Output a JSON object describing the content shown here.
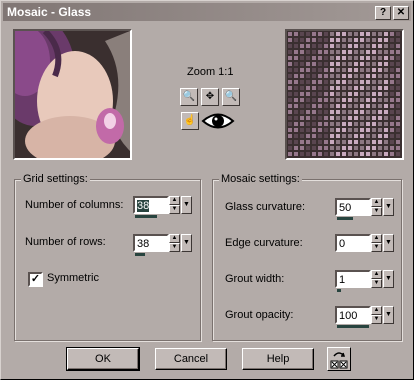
{
  "window": {
    "title": "Mosaic - Glass",
    "help_btn": "?",
    "close_btn": "✕"
  },
  "preview": {
    "zoom_label": "Zoom 1:1"
  },
  "grid": {
    "title": "Grid settings:",
    "columns_label": "Number of columns:",
    "columns_value": "38",
    "rows_label": "Number of rows:",
    "rows_value": "38",
    "symmetric_label": "Symmetric",
    "symmetric_checked": "✓"
  },
  "mosaic": {
    "title": "Mosaic settings:",
    "glass_label": "Glass curvature:",
    "glass_value": "50",
    "edge_label": "Edge curvature:",
    "edge_value": "0",
    "grout_width_label": "Grout width:",
    "grout_width_value": "1",
    "grout_opacity_label": "Grout opacity:",
    "grout_opacity_value": "100"
  },
  "buttons": {
    "ok": "OK",
    "cancel": "Cancel",
    "help": "Help"
  }
}
